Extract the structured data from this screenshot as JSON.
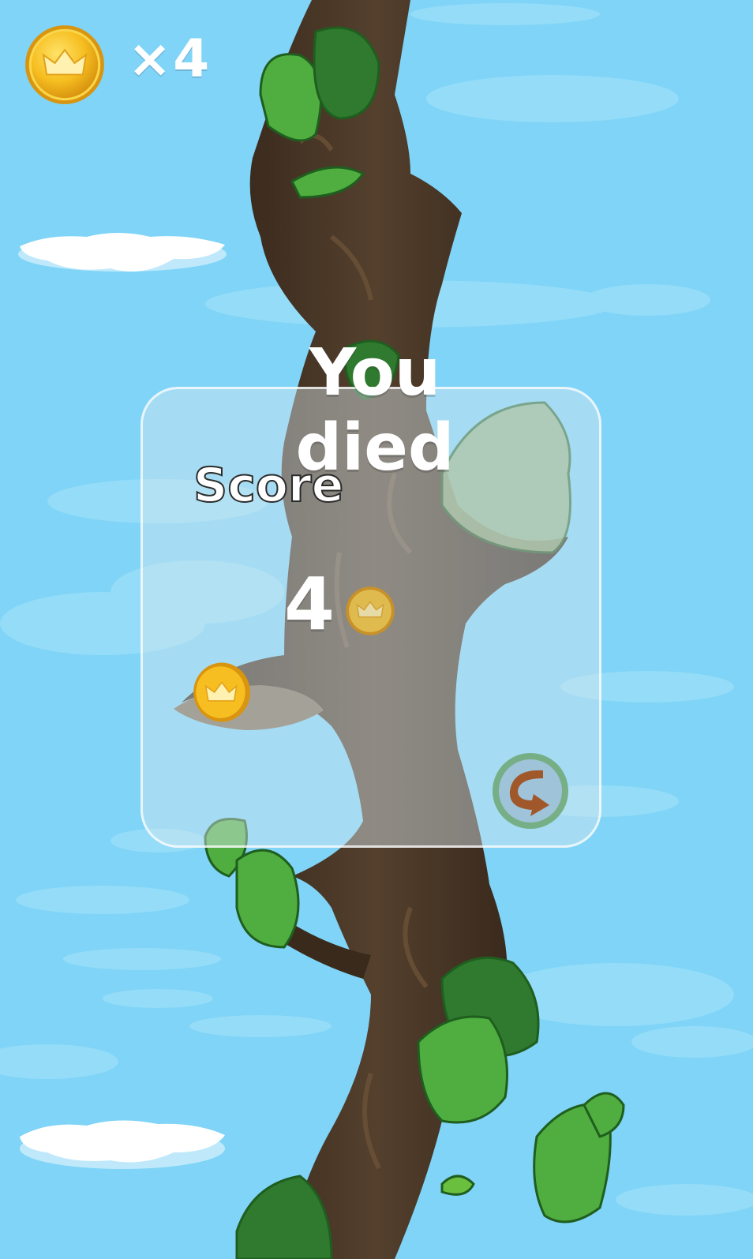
{
  "hud": {
    "coin_icon": "crown-coin-icon",
    "coin_count": "×4"
  },
  "game_over": {
    "title": "You died",
    "score_label": "Score",
    "score_value": "4",
    "score_icon": "crown-coin-icon",
    "restart_icon": "restart-arrow-icon"
  },
  "colors": {
    "sky": "#7fd4f7",
    "coin_gold": "#f2b81a",
    "trunk_dark": "#3b2a1c",
    "leaf_green": "#4fae3f",
    "panel_border": "#ffffff"
  }
}
